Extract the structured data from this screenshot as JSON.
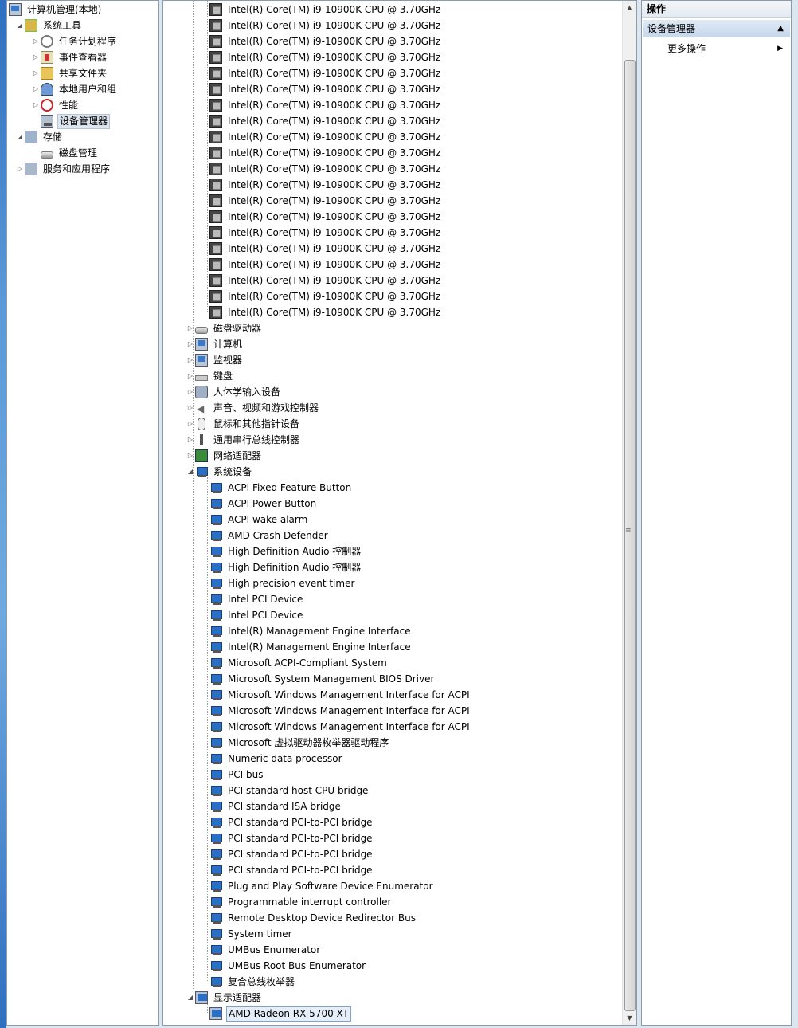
{
  "nav": {
    "root": "计算机管理(本地)",
    "items": [
      {
        "label": "系统工具"
      },
      {
        "label": "任务计划程序"
      },
      {
        "label": "事件查看器"
      },
      {
        "label": "共享文件夹"
      },
      {
        "label": "本地用户和组"
      },
      {
        "label": "性能"
      },
      {
        "label": "设备管理器"
      },
      {
        "label": "存储"
      },
      {
        "label": "磁盘管理"
      },
      {
        "label": "服务和应用程序"
      }
    ]
  },
  "device_tree": {
    "cpu_label": "Intel(R) Core(TM) i9-10900K CPU @ 3.70GHz",
    "categories": {
      "disk_drives": "磁盘驱动器",
      "computer": "计算机",
      "monitors": "监视器",
      "keyboards": "键盘",
      "hid": "人体学输入设备",
      "sound": "声音、视频和游戏控制器",
      "mice": "鼠标和其他指针设备",
      "usb": "通用串行总线控制器",
      "network": "网络适配器",
      "system": "系统设备",
      "display": "显示适配器"
    },
    "system_devices": [
      "ACPI Fixed Feature Button",
      "ACPI Power Button",
      "ACPI wake alarm",
      "AMD Crash Defender",
      "High Definition Audio 控制器",
      "High Definition Audio 控制器",
      "High precision event timer",
      "Intel PCI Device",
      "Intel PCI Device",
      "Intel(R) Management Engine Interface",
      "Intel(R) Management Engine Interface",
      "Microsoft ACPI-Compliant System",
      "Microsoft System Management BIOS Driver",
      "Microsoft Windows Management Interface for ACPI",
      "Microsoft Windows Management Interface for ACPI",
      "Microsoft Windows Management Interface for ACPI",
      "Microsoft 虚拟驱动器枚举器驱动程序",
      "Numeric data processor",
      "PCI bus",
      "PCI standard host CPU bridge",
      "PCI standard ISA bridge",
      "PCI standard PCI-to-PCI bridge",
      "PCI standard PCI-to-PCI bridge",
      "PCI standard PCI-to-PCI bridge",
      "PCI standard PCI-to-PCI bridge",
      "Plug and Play Software Device Enumerator",
      "Programmable interrupt controller",
      "Remote Desktop Device Redirector Bus",
      "System timer",
      "UMBus Enumerator",
      "UMBus Root Bus Enumerator",
      "复合总线枚举器"
    ],
    "display_adapters": [
      "AMD Radeon RX 5700 XT"
    ]
  },
  "actions": {
    "header": "操作",
    "section": "设备管理器",
    "more": "更多操作"
  }
}
